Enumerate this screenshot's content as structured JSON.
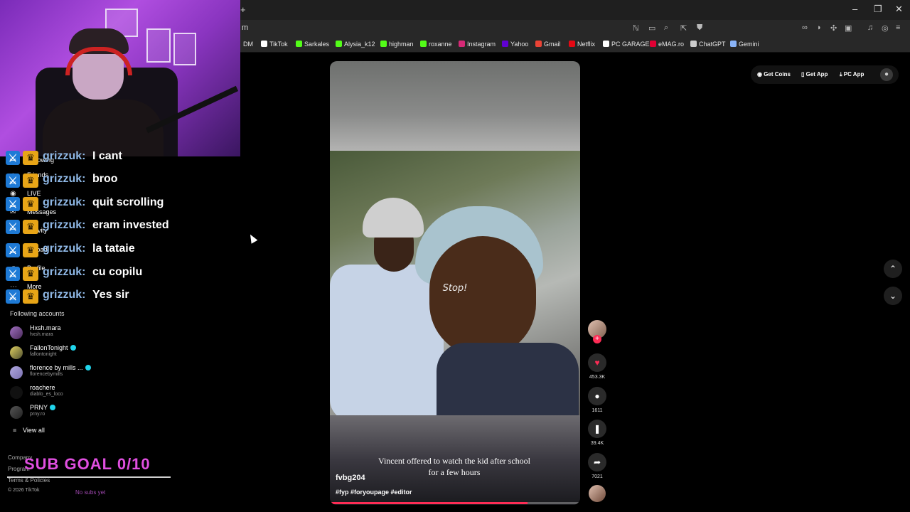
{
  "browser": {
    "url_fragment": "m",
    "bookmarks": [
      {
        "label": "DM",
        "color": ""
      },
      {
        "label": "TikTok",
        "color": "#ffffff"
      },
      {
        "label": "Sarkales",
        "color": "#53fc18"
      },
      {
        "label": "Alysia_k12",
        "color": "#53fc18"
      },
      {
        "label": "highman",
        "color": "#53fc18"
      },
      {
        "label": "roxanne",
        "color": "#53fc18"
      },
      {
        "label": "Instagram",
        "color": "#d62976"
      },
      {
        "label": "Yahoo",
        "color": "#6001d2"
      },
      {
        "label": "Gmail",
        "color": "#ea4335"
      },
      {
        "label": "Netflix",
        "color": "#e50914"
      },
      {
        "label": "PC GARAGE",
        "color": "#ffffff"
      },
      {
        "label": "eMAG.ro",
        "color": "#e00034"
      },
      {
        "label": "ChatGPT",
        "color": "#cccccc"
      },
      {
        "label": "Gemini",
        "color": "#8ab4f8"
      }
    ]
  },
  "sidebar": {
    "nav": [
      {
        "label": "Following",
        "icon": "following-icon"
      },
      {
        "label": "Friends",
        "icon": "friends-icon"
      },
      {
        "label": "LIVE",
        "icon": "live-icon"
      },
      {
        "label": "Messages",
        "icon": "messages-icon"
      },
      {
        "label": "Activity",
        "icon": "activity-icon"
      },
      {
        "label": "Upload",
        "icon": "upload-icon"
      },
      {
        "label": "Profile",
        "icon": "profile-icon"
      },
      {
        "label": "More",
        "icon": "more-icon"
      }
    ],
    "following_title": "Following accounts",
    "accounts": [
      {
        "name": "Hxsh.mara",
        "handle": "hxsh.mara",
        "verified": false
      },
      {
        "name": "FallonTonight",
        "handle": "fallontonight",
        "verified": true
      },
      {
        "name": "florence by mills ...",
        "handle": "florencebymills",
        "verified": true
      },
      {
        "name": "roachere",
        "handle": "diablo_es_loco",
        "verified": false
      },
      {
        "name": "PRNY",
        "handle": "prny.ro",
        "verified": true
      }
    ],
    "view_all": "View all",
    "footer": {
      "company": "Company",
      "program": "Program",
      "terms": "Terms & Policies",
      "copyright": "© 2026 TikTok"
    }
  },
  "chat": {
    "username": "grizzuk:",
    "messages": [
      "I cant",
      "broo",
      "quit scrolling",
      "eram invested",
      "la tataie",
      "cu copilu",
      "Yes sir"
    ]
  },
  "overlay": {
    "sub_goal": "SUB GOAL 0/10",
    "sub_goal_sub": "No subs yet"
  },
  "video": {
    "stop_text": "Stop!",
    "caption_line1": "Vincent offered to watch the kid after school",
    "caption_line2": "for a few hours",
    "author": "fvbg204",
    "tags": "#fyp #foryoupage #editor",
    "progress": 0.79
  },
  "actions": {
    "likes": "453.3K",
    "comments": "1611",
    "saves": "39.4K",
    "shares": "7021"
  },
  "header": {
    "get_coins": "Get Coins",
    "get_app": "Get App",
    "pc_app": "PC App"
  }
}
